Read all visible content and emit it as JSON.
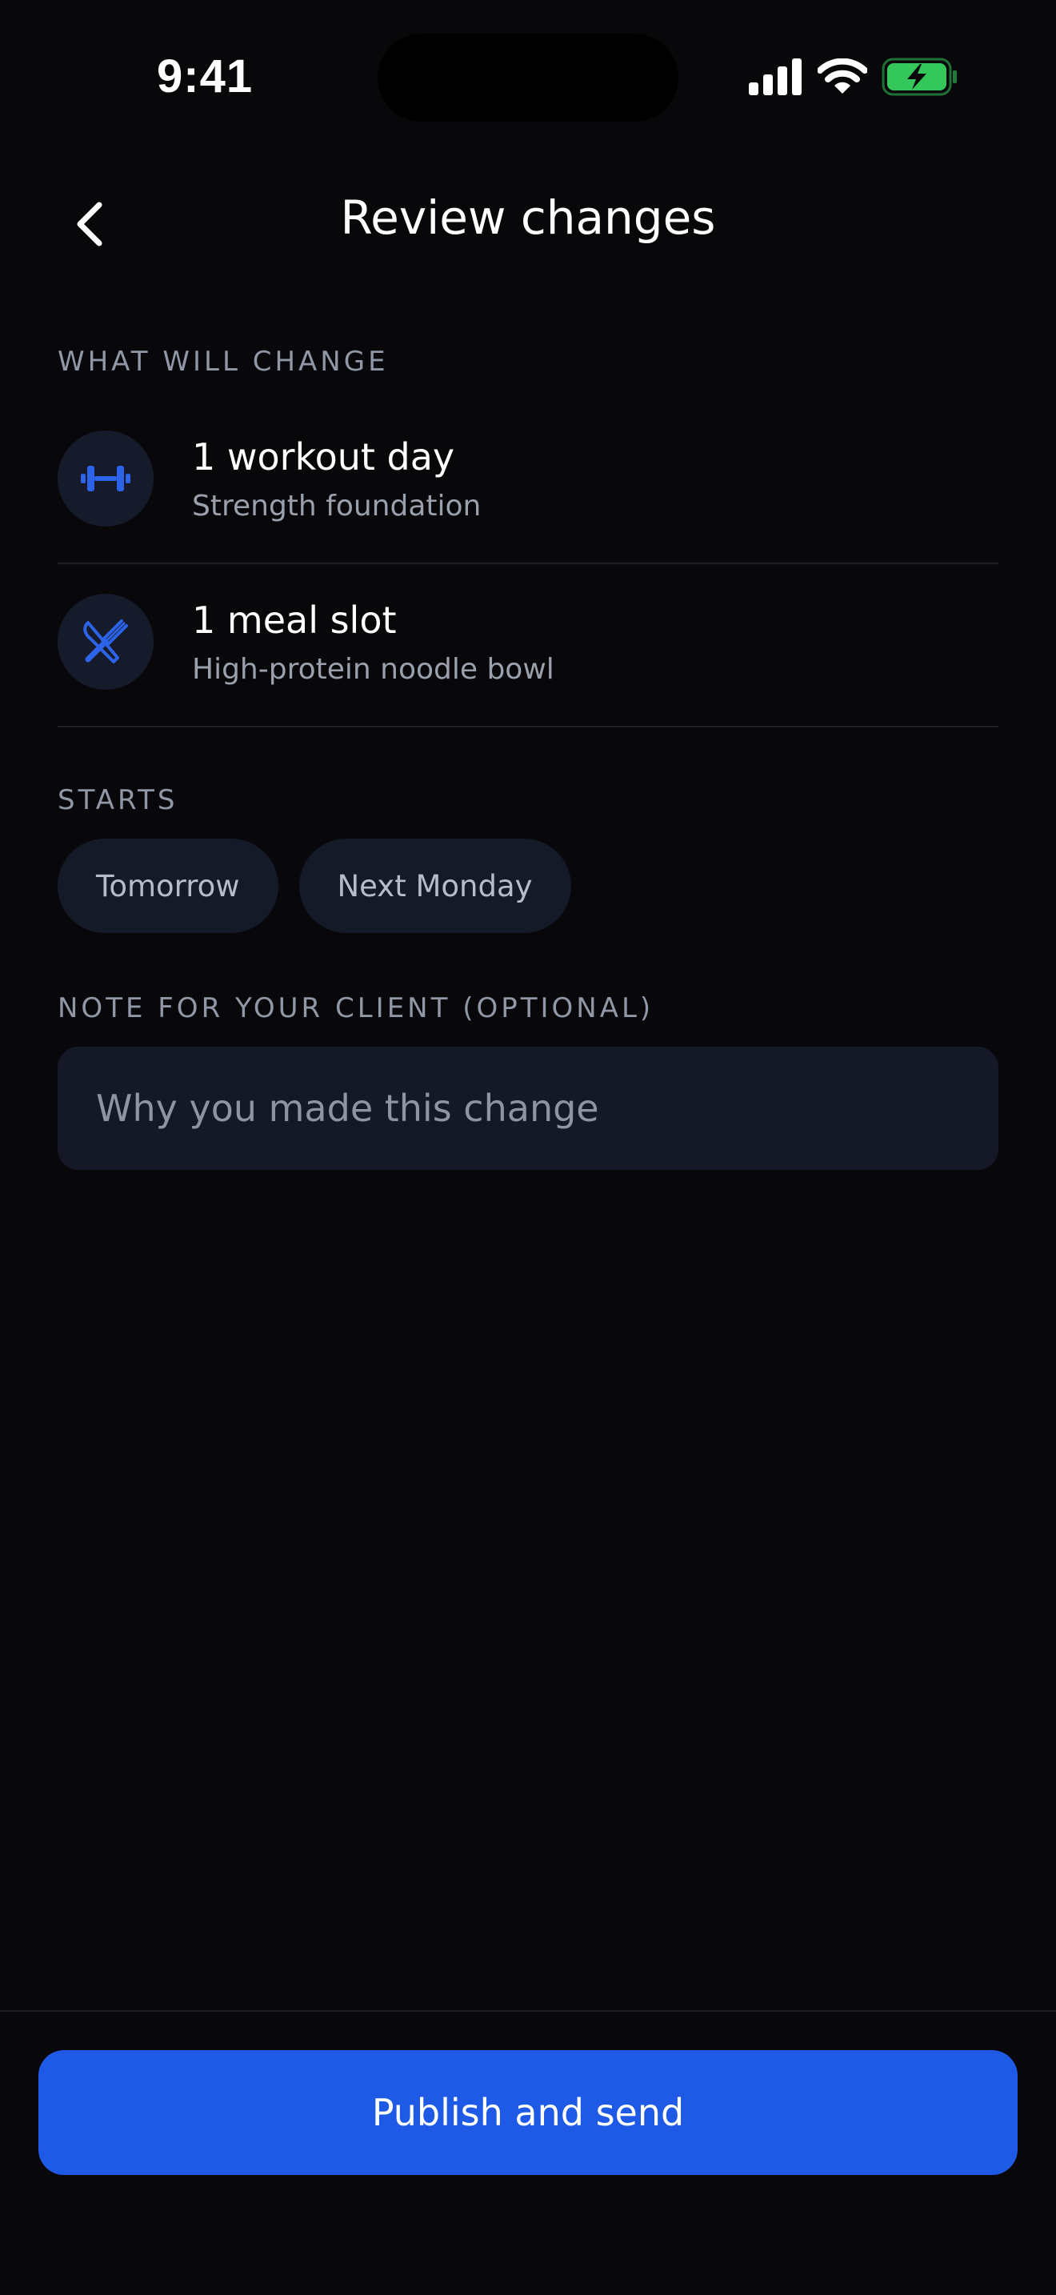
{
  "status_bar": {
    "time": "9:41"
  },
  "header": {
    "title": "Review changes"
  },
  "changes": {
    "label": "WHAT WILL CHANGE",
    "items": [
      {
        "title": "1 workout day",
        "subtitle": "Strength foundation",
        "icon": "dumbbell-icon"
      },
      {
        "title": "1 meal slot",
        "subtitle": "High-protein noodle bowl",
        "icon": "utensils-icon"
      }
    ]
  },
  "starts": {
    "label": "STARTS",
    "options": [
      "Tomorrow",
      "Next Monday"
    ]
  },
  "note": {
    "label": "NOTE FOR YOUR CLIENT (OPTIONAL)",
    "value": "",
    "placeholder": "Why you made this change"
  },
  "footer": {
    "primary_label": "Publish and send"
  },
  "colors": {
    "background": "#08080a",
    "accent": "#1f5ae6",
    "icon_accent": "#2d63e8",
    "battery": "#34c759"
  }
}
